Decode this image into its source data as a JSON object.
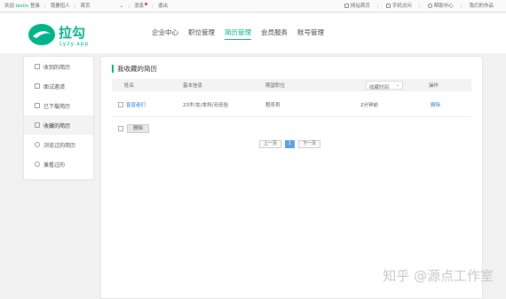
{
  "topbar": {
    "welcome": "欢迎",
    "username": "lastis",
    "login": "登录",
    "switch_role": "我要招人",
    "homepage": "首页",
    "msg": "消息",
    "logout": "退出",
    "nav_home": "网站首页",
    "mobile": "手机访问",
    "help": "帮助中心",
    "our_work": "我们的作品"
  },
  "header": {
    "logo_text": "拉勾",
    "logo_domain": "Lyzy.app",
    "nav": [
      "企业中心",
      "职位管理",
      "简历管理",
      "会员服务",
      "账号管理"
    ],
    "active_nav": "简历管理"
  },
  "sidebar": {
    "items": [
      {
        "label": "收到的简历",
        "icon": "inbox-icon"
      },
      {
        "label": "面试邀请",
        "icon": "calendar-icon"
      },
      {
        "label": "已下载简历",
        "icon": "download-icon"
      },
      {
        "label": "收藏的简历",
        "icon": "star-icon"
      },
      {
        "label": "浏览过的简历",
        "icon": "eye-icon"
      },
      {
        "label": "兼看过的",
        "icon": "user-icon"
      }
    ],
    "active_index": 3
  },
  "main": {
    "title": "我收藏的简历",
    "columns": [
      "姓名",
      "基本信息",
      "期望职位",
      "收藏时间",
      "操作"
    ],
    "rows": [
      {
        "name": "曾曾者们",
        "info": "23岁/女/本科/无经验",
        "position": "程序员",
        "time": "2分钟前",
        "action": "删除"
      }
    ],
    "delete_label": "删除"
  },
  "pager": {
    "prev": "上一页",
    "current": "1",
    "next": "下一页"
  },
  "watermark": "知乎 @源点工作室",
  "colors": {
    "accent": "#00b38a",
    "link": "#2b7fd6",
    "page_active": "#5ba3e0"
  }
}
